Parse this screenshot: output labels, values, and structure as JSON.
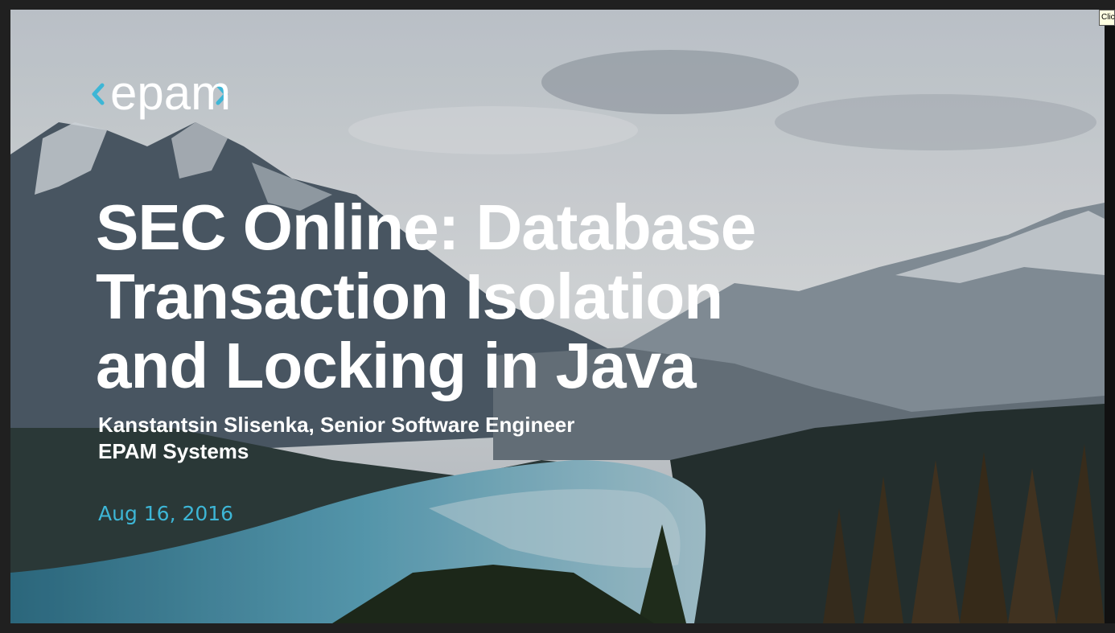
{
  "slide": {
    "logo_text": "epam",
    "title_lines": [
      "SEC Online: Database",
      "Transaction Isolation",
      "and Locking in Java"
    ],
    "subtitle_lines": [
      "Kanstantsin Slisenka, Senior Software Engineer",
      "EPAM Systems"
    ],
    "date": "Aug 16, 2016"
  },
  "tooltip": {
    "text": "Clic"
  },
  "colors": {
    "accent": "#3db6d6",
    "title": "#ffffff",
    "frame": "#202020"
  }
}
